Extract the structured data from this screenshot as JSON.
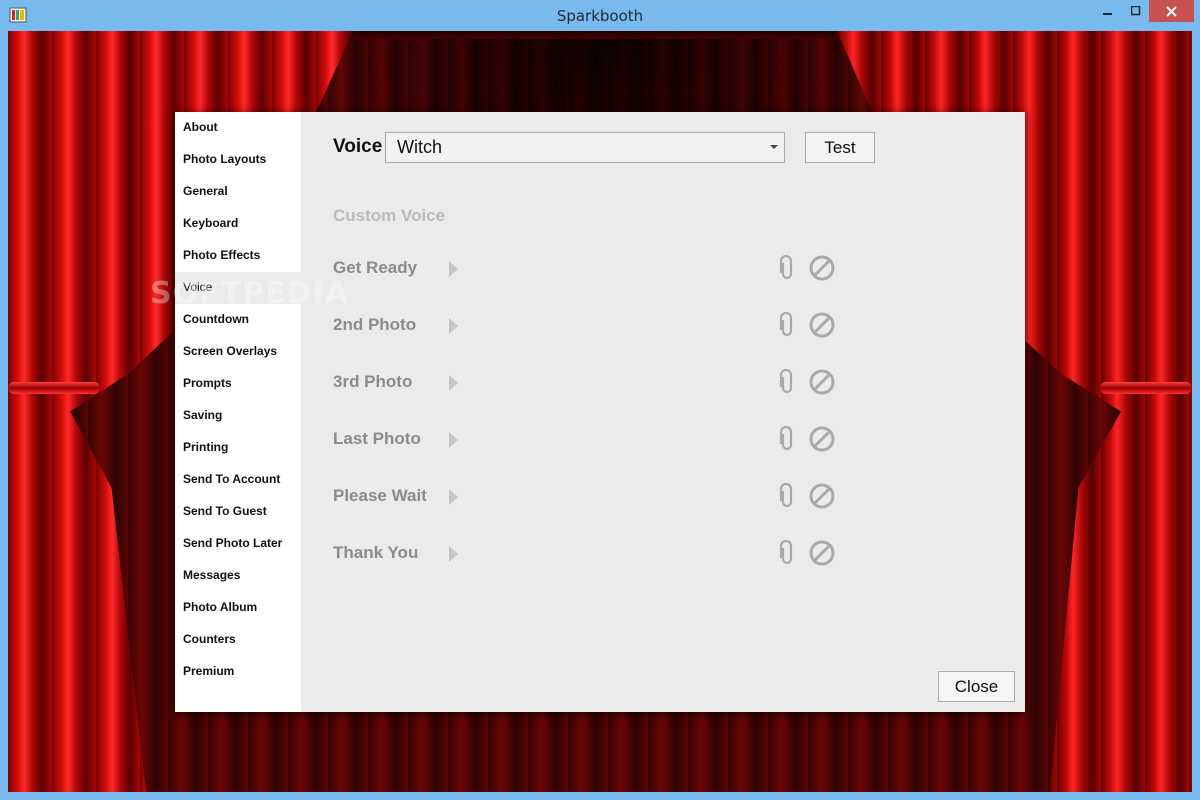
{
  "window": {
    "title": "Sparkbooth"
  },
  "sidebar": {
    "items": [
      {
        "label": "About",
        "active": false
      },
      {
        "label": "Photo Layouts",
        "active": false
      },
      {
        "label": "General",
        "active": false
      },
      {
        "label": "Keyboard",
        "active": false
      },
      {
        "label": "Photo Effects",
        "active": false
      },
      {
        "label": "Voice",
        "active": true
      },
      {
        "label": "Countdown",
        "active": false
      },
      {
        "label": "Screen Overlays",
        "active": false
      },
      {
        "label": "Prompts",
        "active": false
      },
      {
        "label": "Saving",
        "active": false
      },
      {
        "label": "Printing",
        "active": false
      },
      {
        "label": "Send To Account",
        "active": false
      },
      {
        "label": "Send To Guest",
        "active": false
      },
      {
        "label": "Send Photo Later",
        "active": false
      },
      {
        "label": "Messages",
        "active": false
      },
      {
        "label": "Photo Album",
        "active": false
      },
      {
        "label": "Counters",
        "active": false
      },
      {
        "label": "Premium",
        "active": false
      }
    ]
  },
  "watermark": "SOFTPEDIA",
  "voice": {
    "label": "Voice",
    "selected": "Witch",
    "test_label": "Test"
  },
  "custom_voice": {
    "heading": "Custom Voice",
    "rows": [
      {
        "label": "Get Ready"
      },
      {
        "label": "2nd Photo"
      },
      {
        "label": "3rd Photo"
      },
      {
        "label": "Last Photo"
      },
      {
        "label": "Please Wait"
      },
      {
        "label": "Thank You"
      }
    ]
  },
  "footer": {
    "close_label": "Close"
  },
  "colors": {
    "titlebar": "#78b9ee",
    "close_button": "#c75050",
    "dialog_bg": "#ebebeb",
    "sidebar_bg": "#ffffff",
    "muted_text": "#8b8b8b",
    "disabled_heading": "#b9b9b9",
    "icon_gray": "#a9a9a9"
  },
  "icons": {
    "app": "sparkbooth-app-icon",
    "play": "play-icon",
    "attach": "paperclip-icon",
    "clear": "no-entry-icon"
  }
}
